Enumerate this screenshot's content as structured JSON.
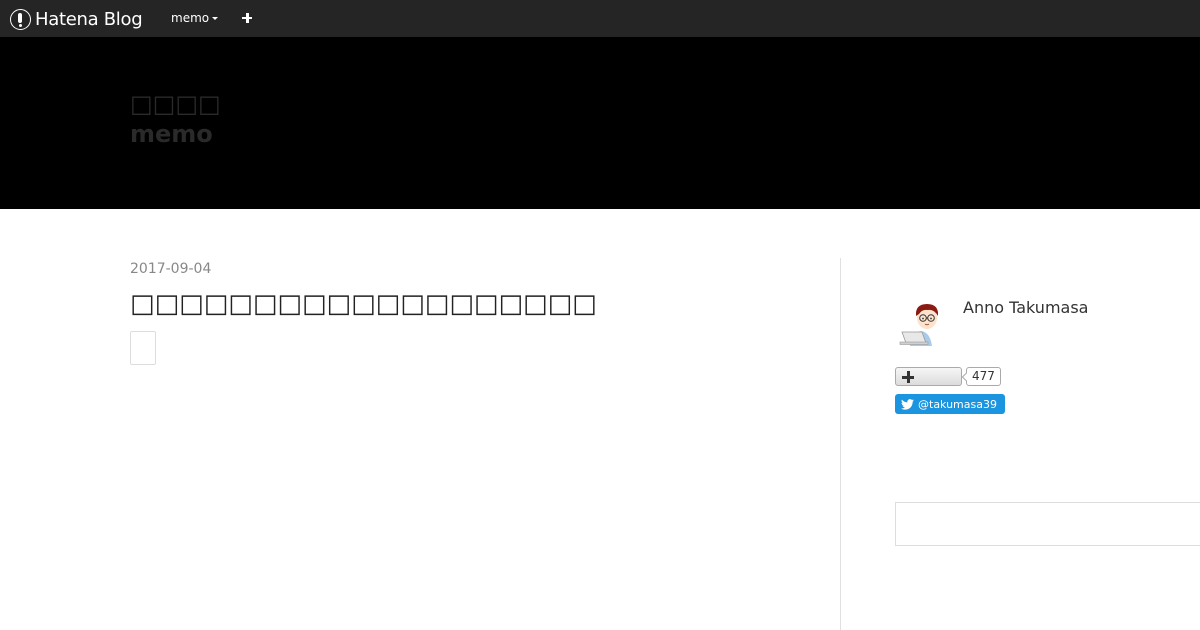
{
  "globalbar": {
    "logo_text": "Hatena Blog",
    "blog_menu_label": "memo",
    "add_icon": "plus-icon"
  },
  "header": {
    "title_line1": "□□□□",
    "title_line2": "memo"
  },
  "entry": {
    "date": "2017-09-04",
    "title": "□□□□□□□□□□□□□□□□□□□"
  },
  "sidebar": {
    "author_name": "Anno Takumasa",
    "subscribe_count": "477",
    "twitter_label": "@takumasa39"
  },
  "colors": {
    "globalbar_bg": "#252525",
    "header_bg": "#000000",
    "twitter_blue": "#1b95e0",
    "date_gray": "#888888"
  }
}
